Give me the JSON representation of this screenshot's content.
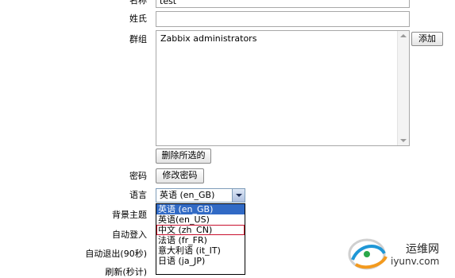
{
  "form": {
    "name": {
      "label": "名称",
      "value": "test"
    },
    "surname": {
      "label": "姓氏",
      "value": ""
    },
    "groups": {
      "label": "群组",
      "items": [
        "Zabbix administrators"
      ],
      "add_button": "添加",
      "remove_button": "删除所选的"
    },
    "password": {
      "label": "密码",
      "button": "修改密码"
    },
    "language": {
      "label": "语言",
      "selected": "英语 (en_GB)",
      "options": [
        "英语 (en_GB)",
        "英语(en_US)",
        "中文 (zh_CN)",
        "法语 (fr_FR)",
        "意大利语 (it_IT)",
        "日语 (ja_JP)"
      ],
      "highlighted_index": 0,
      "hover_index": 2
    },
    "theme": {
      "label": "背景主题"
    },
    "autologin": {
      "label": "自动登入"
    },
    "autologout": {
      "label": "自动退出(90秒)"
    },
    "refresh": {
      "label": "刷新(秒计)"
    }
  },
  "watermark": {
    "line1": "运维网",
    "line2": "iyunv.com"
  }
}
